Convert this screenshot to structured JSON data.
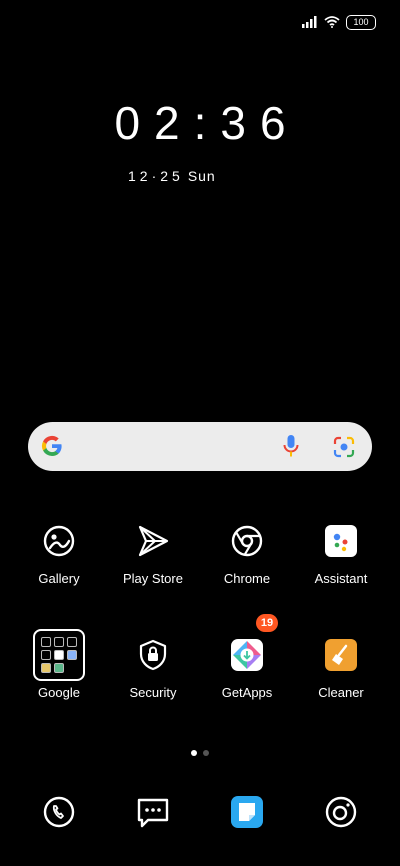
{
  "status_bar": {
    "battery": "100",
    "icons": [
      "signal-icon",
      "wifi-icon",
      "battery-icon"
    ]
  },
  "clock": {
    "time": "02:36",
    "date": "12·25",
    "day": "Sun"
  },
  "search_bar": {
    "icons": [
      "google-logo-icon",
      "mic-icon",
      "google-lens-icon"
    ]
  },
  "apps": {
    "gallery": {
      "label": "Gallery",
      "icon": "gallery-icon"
    },
    "play_store": {
      "label": "Play Store",
      "icon": "play-store-icon"
    },
    "chrome": {
      "label": "Chrome",
      "icon": "chrome-icon"
    },
    "assistant": {
      "label": "Assistant",
      "icon": "assistant-icon"
    },
    "google": {
      "label": "Google",
      "icon": "folder-icon"
    },
    "security": {
      "label": "Security",
      "icon": "shield-lock-icon"
    },
    "getapps": {
      "label": "GetApps",
      "icon": "getapps-icon",
      "badge": "19"
    },
    "cleaner": {
      "label": "Cleaner",
      "icon": "broom-icon"
    }
  },
  "page_indicator": {
    "pages": 2,
    "current": 1
  },
  "dock": [
    {
      "name": "phone",
      "icon": "phone-icon"
    },
    {
      "name": "messages",
      "icon": "messages-icon"
    },
    {
      "name": "notes",
      "icon": "notes-icon"
    },
    {
      "name": "camera",
      "icon": "camera-icon"
    }
  ],
  "colors": {
    "background": "#000000",
    "search_bg": "#ececec",
    "badge": "#ff5722",
    "cleaner": "#f0a030",
    "notes": "#2aa8f0"
  }
}
